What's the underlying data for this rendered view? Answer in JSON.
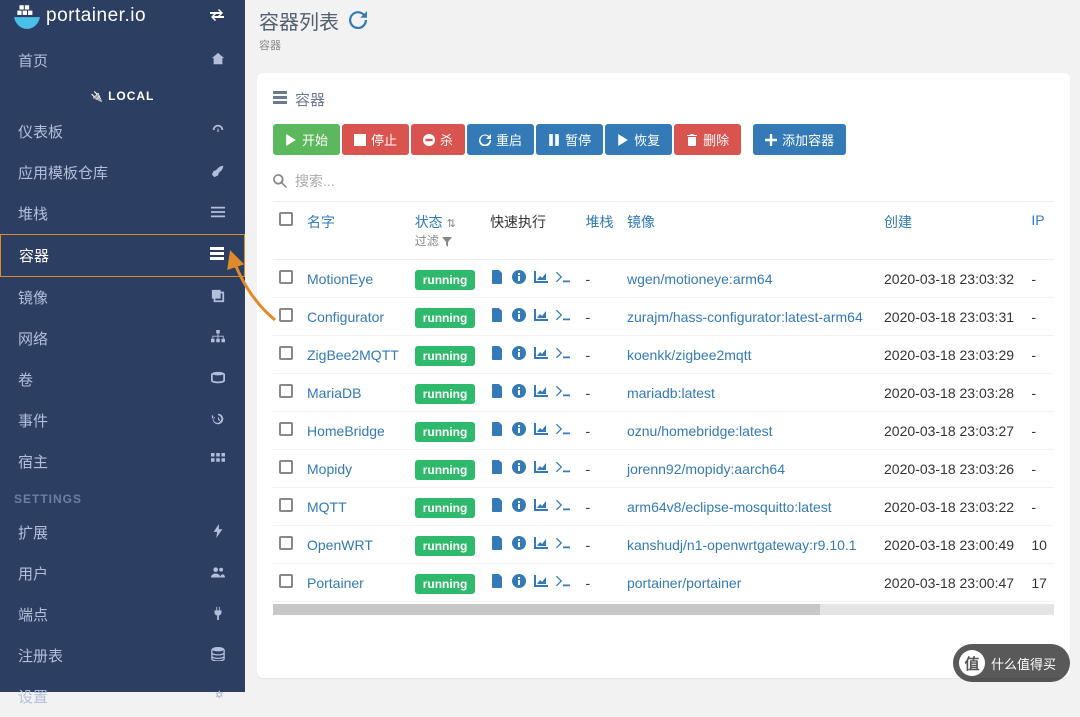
{
  "brand": "portainer.io",
  "page": {
    "title": "容器列表",
    "breadcrumb": "容器"
  },
  "local_label": "LOCAL",
  "sidebar": {
    "home": "首页",
    "items": [
      {
        "label": "仪表板",
        "icon": "dashboard"
      },
      {
        "label": "应用模板仓库",
        "icon": "rocket"
      },
      {
        "label": "堆栈",
        "icon": "list"
      },
      {
        "label": "容器",
        "icon": "bars",
        "active": true
      },
      {
        "label": "镜像",
        "icon": "clone"
      },
      {
        "label": "网络",
        "icon": "sitemap"
      },
      {
        "label": "卷",
        "icon": "hdd"
      },
      {
        "label": "事件",
        "icon": "history"
      },
      {
        "label": "宿主",
        "icon": "th"
      }
    ],
    "settings_label": "SETTINGS",
    "settings": [
      {
        "label": "扩展",
        "icon": "bolt"
      },
      {
        "label": "用户",
        "icon": "users"
      },
      {
        "label": "端点",
        "icon": "plug"
      },
      {
        "label": "注册表",
        "icon": "database"
      },
      {
        "label": "设置",
        "icon": "cogs"
      }
    ]
  },
  "panel_title": "容器",
  "actions": {
    "start": "开始",
    "stop": "停止",
    "kill": "杀",
    "restart": "重启",
    "pause": "暂停",
    "resume": "恢复",
    "remove": "删除",
    "add": "添加容器"
  },
  "search_placeholder": "搜索...",
  "columns": {
    "name": "名字",
    "state": "状态",
    "state_filter": "过滤",
    "quick": "快速执行",
    "stack": "堆栈",
    "image": "镜像",
    "created": "创建",
    "ip": "IP"
  },
  "rows": [
    {
      "name": "MotionEye",
      "state": "running",
      "stack": "-",
      "image": "wgen/motioneye:arm64",
      "created": "2020-03-18 23:03:32",
      "ip": "-"
    },
    {
      "name": "Configurator",
      "state": "running",
      "stack": "-",
      "image": "zurajm/hass-configurator:latest-arm64",
      "created": "2020-03-18 23:03:31",
      "ip": "-"
    },
    {
      "name": "ZigBee2MQTT",
      "state": "running",
      "stack": "-",
      "image": "koenkk/zigbee2mqtt",
      "created": "2020-03-18 23:03:29",
      "ip": "-"
    },
    {
      "name": "MariaDB",
      "state": "running",
      "stack": "-",
      "image": "mariadb:latest",
      "created": "2020-03-18 23:03:28",
      "ip": "-"
    },
    {
      "name": "HomeBridge",
      "state": "running",
      "stack": "-",
      "image": "oznu/homebridge:latest",
      "created": "2020-03-18 23:03:27",
      "ip": "-"
    },
    {
      "name": "Mopidy",
      "state": "running",
      "stack": "-",
      "image": "jorenn92/mopidy:aarch64",
      "created": "2020-03-18 23:03:26",
      "ip": "-"
    },
    {
      "name": "MQTT",
      "state": "running",
      "stack": "-",
      "image": "arm64v8/eclipse-mosquitto:latest",
      "created": "2020-03-18 23:03:22",
      "ip": "-"
    },
    {
      "name": "OpenWRT",
      "state": "running",
      "stack": "-",
      "image": "kanshudj/n1-openwrtgateway:r9.10.1",
      "created": "2020-03-18 23:00:49",
      "ip": "10"
    },
    {
      "name": "Portainer",
      "state": "running",
      "stack": "-",
      "image": "portainer/portainer",
      "created": "2020-03-18 23:00:47",
      "ip": "17"
    }
  ],
  "watermark": "什么值得买"
}
